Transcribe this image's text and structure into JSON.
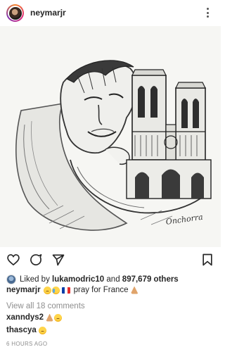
{
  "post": {
    "username": "neymarjr",
    "avatar_icon": "profile-avatar",
    "more_icon": "more-options-icon"
  },
  "image": {
    "description_icon": "sketch-illustration",
    "signature": "Onchorra"
  },
  "actions": {
    "like_icon": "heart-icon",
    "comment_icon": "comment-icon",
    "share_icon": "send-icon",
    "save_icon": "bookmark-icon"
  },
  "likes": {
    "prefix": "Liked by",
    "user": "lukamodric10",
    "and": "and",
    "count": "897,679 others"
  },
  "caption": {
    "username": "neymarjr",
    "text": "pray for France"
  },
  "comments": {
    "view_all": "View all 18 comments",
    "items": [
      {
        "username": "xanndys2"
      },
      {
        "username": "thascya"
      }
    ]
  },
  "timestamp": "6 HOURS AGO"
}
